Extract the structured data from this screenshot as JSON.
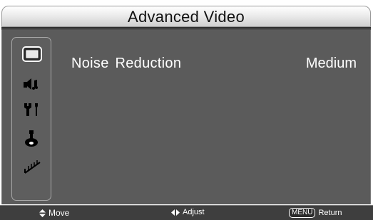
{
  "header": {
    "title": "Advanced Video"
  },
  "sidebar": {
    "items": [
      {
        "icon": "picture-icon",
        "active": true
      },
      {
        "icon": "sound-icon",
        "active": false
      },
      {
        "icon": "setup-tools-icon",
        "active": false
      },
      {
        "icon": "parental-lock-icon",
        "active": false
      },
      {
        "icon": "antenna-channel-icon",
        "active": false
      }
    ]
  },
  "settings": {
    "rows": [
      {
        "label": "Noise  Reduction",
        "value": "Medium"
      }
    ]
  },
  "footer": {
    "move_label": "Move",
    "adjust_label": "Adjust",
    "menu_key_label": "MENU",
    "return_label": "Return"
  }
}
